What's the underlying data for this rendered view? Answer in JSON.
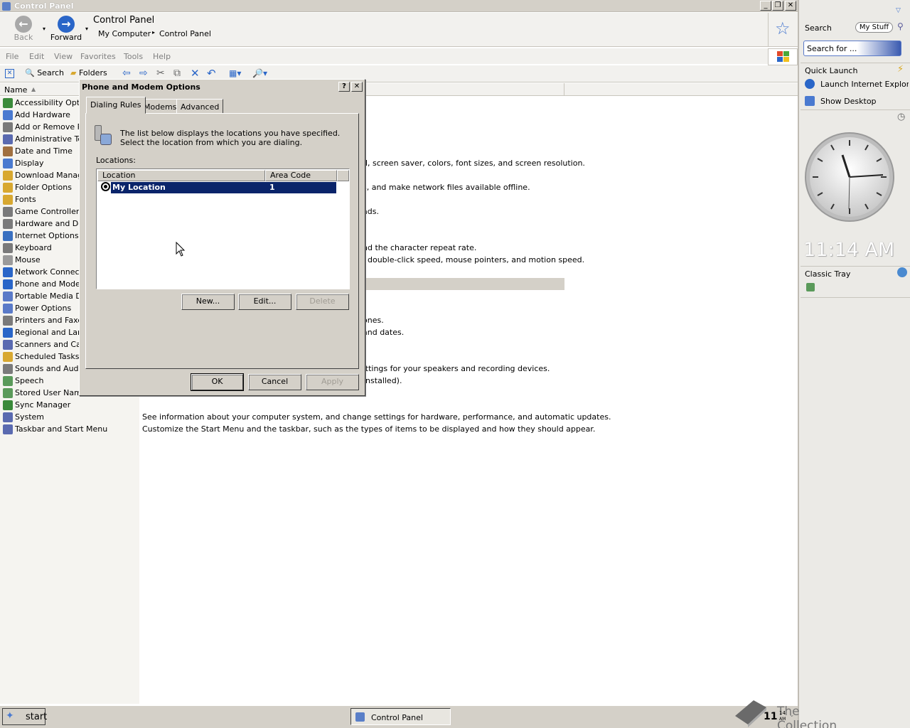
{
  "window": {
    "title": "Control Panel"
  },
  "nav": {
    "back": "Back",
    "forward": "Forward",
    "location_title": "Control Panel",
    "breadcrumb": [
      "My Computer",
      "Control Panel"
    ]
  },
  "menu": [
    "File",
    "Edit",
    "View",
    "Favorites",
    "Tools",
    "Help"
  ],
  "toolbar": {
    "search": "Search",
    "folders": "Folders"
  },
  "list": {
    "column_name": "Name",
    "items": [
      "Accessibility Options",
      "Add Hardware",
      "Add or Remove Programs",
      "Administrative Tools",
      "Date and Time",
      "Display",
      "Download Manager",
      "Folder Options",
      "Fonts",
      "Game Controllers",
      "Hardware and Devices",
      "Internet Options",
      "Keyboard",
      "Mouse",
      "Network Connections",
      "Phone and Modem",
      "Portable Media Devices",
      "Power Options",
      "Printers and Faxes",
      "Regional and Language",
      "Scanners and Cameras",
      "Scheduled Tasks",
      "Sounds and Audio",
      "Speech",
      "Stored User Names",
      "Sync Manager",
      "System",
      "Taskbar and Start Menu"
    ],
    "descriptions": {
      "display": "d, screen saver, colors, font sizes, and screen resolution.",
      "folder": "s, and make network files available offline.",
      "fonts": "ads.",
      "keyboard": "nd the character repeat rate.",
      "mouse": ", double-click speed, mouse pointers, and motion speed.",
      "printers": "ones.",
      "regional": "and dates.",
      "sounds": "ettings for your speakers and recording devices.",
      "speech": " installed).",
      "system": "See information about your computer system, and change settings for hardware, performance, and automatic updates.",
      "taskbar": "Customize the Start Menu and the taskbar, such as the types of items to be displayed and how they should appear."
    }
  },
  "dialog": {
    "title": "Phone and Modem Options",
    "tabs": [
      "Dialing Rules",
      "Modems",
      "Advanced"
    ],
    "intro": "The list below displays the locations you have specified. Select the location from which you are dialing.",
    "locations_label": "Locations:",
    "columns": [
      "Location",
      "Area Code"
    ],
    "rows": [
      {
        "location": "My Location",
        "area_code": "1"
      }
    ],
    "buttons": {
      "new": "New...",
      "edit": "Edit...",
      "delete": "Delete",
      "ok": "OK",
      "cancel": "Cancel",
      "apply": "Apply"
    }
  },
  "sidebar": {
    "search_label": "Search",
    "my_stuff": "My Stuff",
    "search_placeholder": "Search for ...",
    "quick_launch": "Quick Launch",
    "launch_ie": "Launch Internet Explorer",
    "show_desktop": "Show Desktop",
    "time": "11:14 AM",
    "classic_tray": "Classic Tray"
  },
  "taskbar": {
    "start": "start",
    "task": "Control Panel",
    "clock_hour": "11",
    "clock_min": "14",
    "clock_ampm": "AM",
    "watermark": "The Collection Book"
  },
  "colors": {
    "selection": "#0a246a",
    "accent": "#2a66c8"
  }
}
